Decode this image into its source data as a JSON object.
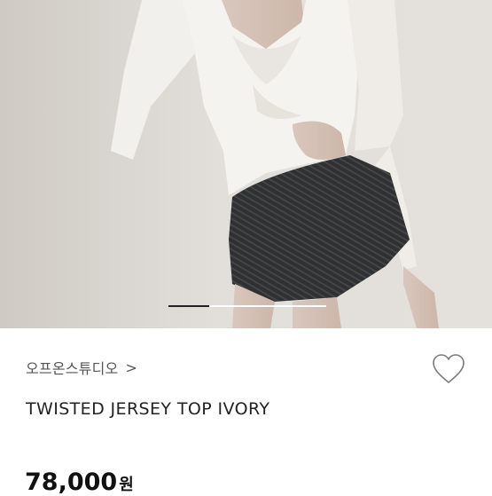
{
  "product": {
    "brand": "오프온스튜디오",
    "brand_chevron": ">",
    "title": "TWISTED JERSEY TOP IVORY",
    "price": "78,000",
    "currency": "원",
    "like_icon": "heart-outline-icon"
  },
  "gallery": {
    "image_description_icon": "product-photo",
    "total_slides": 3,
    "active_slide": 1
  },
  "colors": {
    "indicator_active": "#222222",
    "indicator_inactive": "#ffffff",
    "text_primary": "#222222"
  }
}
